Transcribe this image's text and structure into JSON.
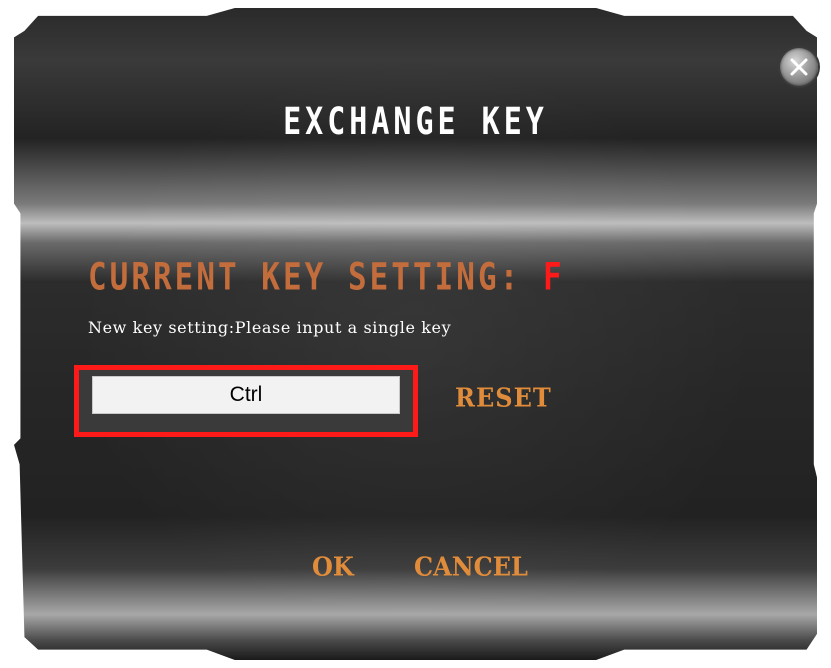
{
  "dialog": {
    "title": "EXCHANGE KEY",
    "close_icon": "close-x-icon",
    "current_key_label": "CURRENT KEY SETTING:",
    "current_key_value": "F",
    "instruction": "New key setting:Please input a single key",
    "key_input_value": "Ctrl",
    "reset_label": "RESET",
    "ok_label": "OK",
    "cancel_label": "CANCEL"
  },
  "colors": {
    "label_orange": "#c36c3c",
    "button_orange": "#e08c3a",
    "current_value_red": "#ff1a1a",
    "highlight_border_red": "#ff1a1a",
    "title_white": "#ffffff"
  }
}
